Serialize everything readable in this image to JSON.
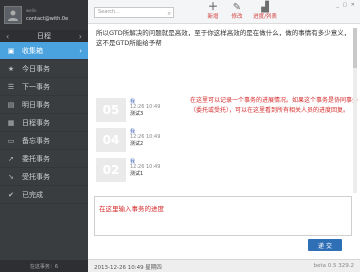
{
  "profile": {
    "small_text": "welin",
    "user": "contact@with.0e"
  },
  "nav": {
    "header": "日程",
    "items": [
      {
        "label": "收集箱",
        "icon": "inbox-icon",
        "glyph": "▣",
        "active": true
      },
      {
        "label": "今日事务",
        "icon": "star-icon",
        "glyph": "★",
        "active": false
      },
      {
        "label": "下一事务",
        "icon": "list-icon",
        "glyph": "☰",
        "active": false
      },
      {
        "label": "明日事务",
        "icon": "calendar-icon",
        "glyph": "▤",
        "active": false
      },
      {
        "label": "日程事务",
        "icon": "calendar-grid-icon",
        "glyph": "▦",
        "active": false
      },
      {
        "label": "备忘事务",
        "icon": "folder-icon",
        "glyph": "▭",
        "active": false
      },
      {
        "label": "委托事务",
        "icon": "delegate-icon",
        "glyph": "➚",
        "active": false
      },
      {
        "label": "受托事务",
        "icon": "receive-icon",
        "glyph": "➘",
        "active": false
      },
      {
        "label": "已完成",
        "icon": "check-icon",
        "glyph": "✔",
        "active": false
      }
    ],
    "footer": "在这事务：6"
  },
  "toolbar": {
    "search_placeholder": "Search...",
    "new_label": "新增",
    "edit_label": "修改",
    "progress_label": "进度/列表"
  },
  "question": "所以GTD所解决的问题就是高效，至于你这样高效的是在做什么，做的事情有多少意义，这不是GTD所能给予帮",
  "records": [
    {
      "num": "05",
      "name": "我",
      "time": "12:26 10:49",
      "content": "测试3"
    },
    {
      "num": "04",
      "name": "我",
      "time": "12:26 10:49",
      "content": "测试2"
    },
    {
      "num": "02",
      "name": "我",
      "time": "12:26 10:49",
      "content": "测试1"
    }
  ],
  "annotation": "在这里可以记录一个事务的进展情况。如果这个事务是协同事务（委托或受托），可以在这里看到所有相关人员的进度回复。",
  "input_placeholder": "在这里输入事务的进度",
  "submit_label": "递 交",
  "status": {
    "datetime": "2013-12-26 10:49 星期四",
    "version": "beta 0.5 329.2"
  },
  "colors": {
    "accent": "#4aa3df",
    "sidebar": "#3a3d40",
    "annotation": "#d42b2b",
    "submit": "#2f6fb5"
  }
}
